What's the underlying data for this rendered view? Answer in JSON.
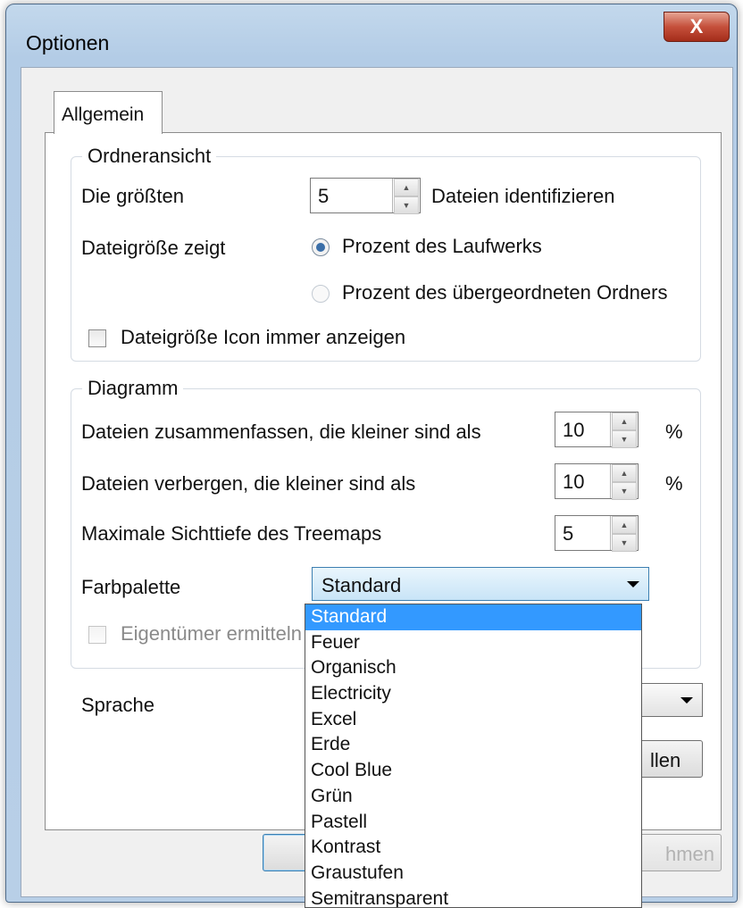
{
  "window": {
    "title": "Optionen",
    "close_label": "X"
  },
  "tabs": [
    {
      "label": "Allgemein"
    }
  ],
  "folder_view": {
    "group_label": "Ordneransicht",
    "identify_label": "Die größten",
    "identify_value": "5",
    "identify_suffix": "Dateien identifizieren",
    "size_shows_label": "Dateigröße zeigt",
    "radio_drive": "Prozent des Laufwerks",
    "radio_parent": "Prozent des übergeordneten Ordners",
    "always_show_label": "Dateigröße Icon immer anzeigen"
  },
  "diagram": {
    "group_label": "Diagramm",
    "merge_label": "Dateien zusammenfassen, die kleiner sind als",
    "merge_value": "10",
    "merge_unit": "%",
    "hide_label": "Dateien verbergen, die kleiner sind als",
    "hide_value": "10",
    "hide_unit": "%",
    "depth_label": "Maximale Sichttiefe des Treemaps",
    "depth_value": "5",
    "palette_label": "Farbpalette",
    "palette_value": "Standard",
    "owner_label": "Eigentümer ermitteln"
  },
  "language": {
    "label": "Sprache"
  },
  "partial_buttons": {
    "right_button": "llen",
    "apply_button": "hmen"
  },
  "palette_options": [
    "Standard",
    "Feuer",
    "Organisch",
    "Electricity",
    "Excel",
    "Erde",
    "Cool Blue",
    "Grün",
    "Pastell",
    "Kontrast",
    "Graustufen",
    "Semitransparent"
  ],
  "palette_selected_index": 0,
  "colors": {
    "accent": "#3399ff",
    "combo_border": "#3c7fb1",
    "close": "#c5503b"
  }
}
